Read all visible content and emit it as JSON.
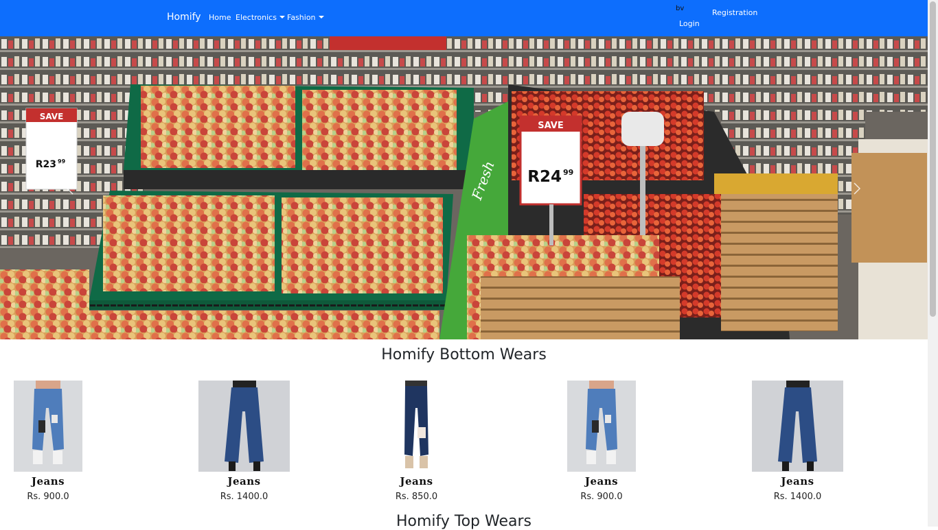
{
  "navbar": {
    "brand": "Homify",
    "links": [
      "Home",
      "Electronics",
      "Fashion"
    ],
    "user": "bv",
    "login": "Login",
    "registration": "Registration",
    "color": "#0d6efd"
  },
  "hero": {
    "price_tag_left": {
      "label": "SAVE",
      "price": "R23",
      "cents": "99"
    },
    "price_tag_right": {
      "label": "SAVE",
      "price": "R24",
      "cents": "99"
    },
    "sign_text": "Fresh"
  },
  "sections": {
    "bottom_wears": "Homify Bottom Wears",
    "top_wears": "Homify Top Wears"
  },
  "products": [
    {
      "name": "Jeans",
      "price": "Rs. 900.0"
    },
    {
      "name": "Jeans",
      "price": "Rs. 1400.0"
    },
    {
      "name": "Jeans",
      "price": "Rs. 850.0"
    },
    {
      "name": "Jeans",
      "price": "Rs. 900.0"
    },
    {
      "name": "Jeans",
      "price": "Rs. 1400.0"
    }
  ]
}
